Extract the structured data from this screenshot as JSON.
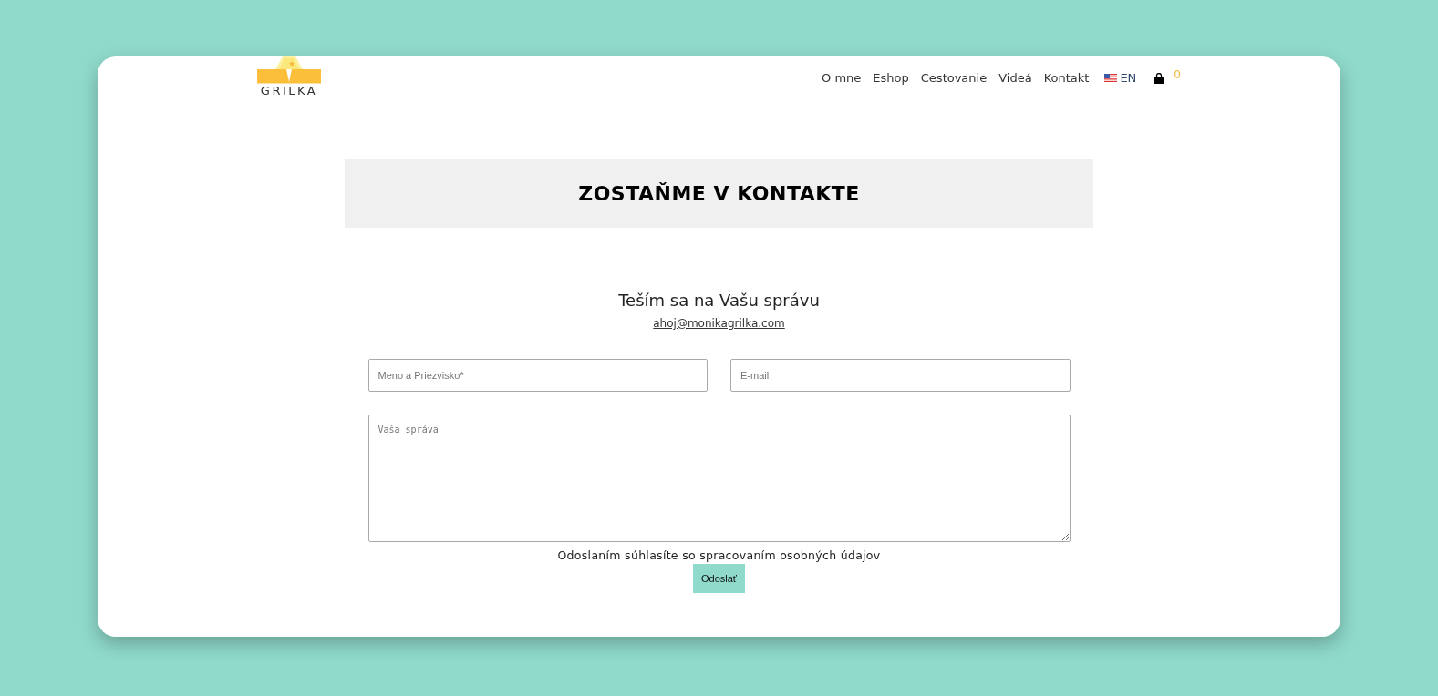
{
  "logo": {
    "text": "GRILKA"
  },
  "nav": [
    {
      "label": "O mne"
    },
    {
      "label": "Eshop"
    },
    {
      "label": "Cestovanie"
    },
    {
      "label": "Videá"
    },
    {
      "label": "Kontakt"
    }
  ],
  "language": {
    "label": "EN"
  },
  "cart": {
    "count": "0"
  },
  "banner": {
    "title": "ZOSTAŇME V KONTAKTE"
  },
  "intro": {
    "heading": "Teším sa na Vašu správu",
    "email": "ahoj@monikagrilka.com"
  },
  "form": {
    "fields": [
      {
        "kind": "input",
        "placeholder": "Meno a Priezvisko*"
      },
      {
        "kind": "input",
        "placeholder": "E-mail"
      },
      {
        "kind": "textarea",
        "placeholder": "Vaša správa"
      }
    ],
    "consent": "Odoslaním súhlasíte so spracovaním osobných údajov",
    "submit": "Odoslať"
  }
}
